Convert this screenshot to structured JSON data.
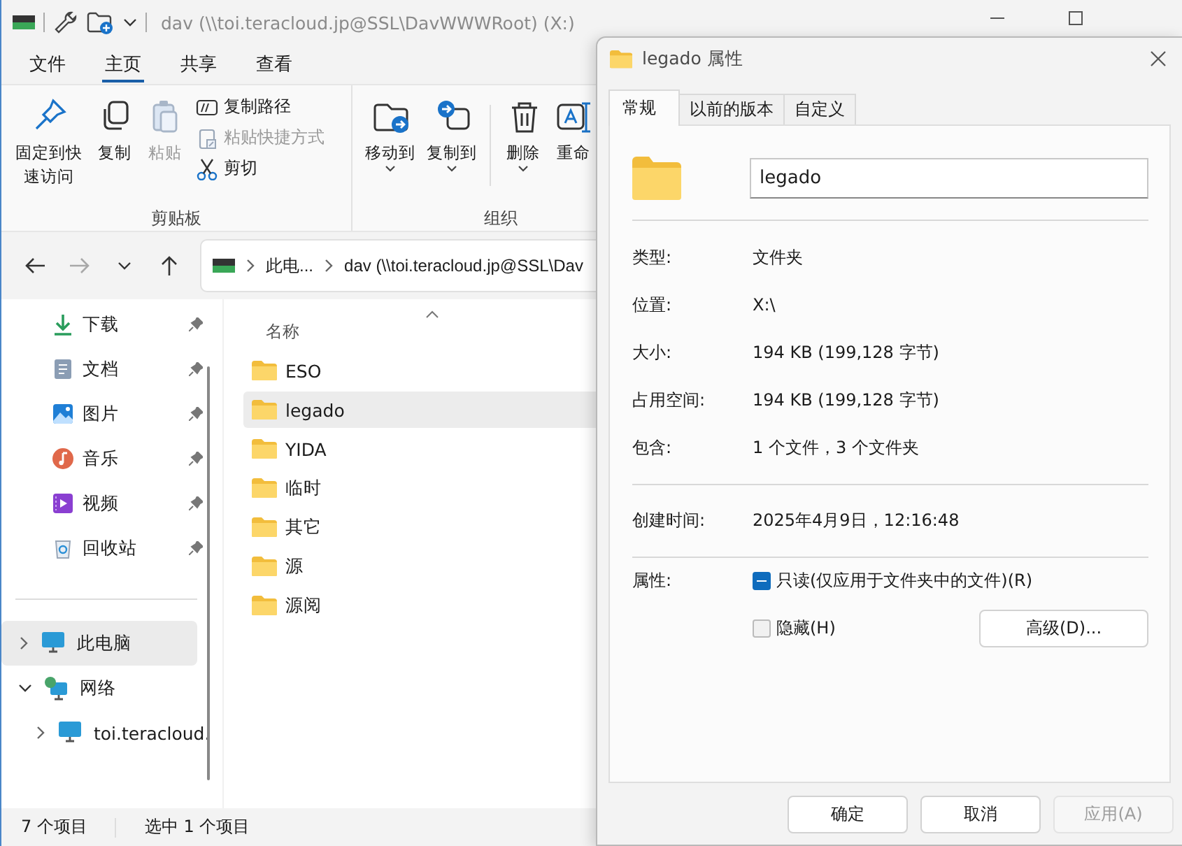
{
  "explorer": {
    "title": "dav (\\\\toi.teracloud.jp@SSL\\DavWWWRoot) (X:)",
    "menu_tabs": [
      {
        "label": "文件",
        "selected": false
      },
      {
        "label": "主页",
        "selected": true
      },
      {
        "label": "共享",
        "selected": false
      },
      {
        "label": "查看",
        "selected": false
      }
    ],
    "ribbon": {
      "groups": [
        {
          "label": "剪贴板",
          "items": [
            {
              "kind": "large",
              "label": "固定到快速访问",
              "disabled": false,
              "dropdown": false
            },
            {
              "kind": "large",
              "label": "复制",
              "disabled": false,
              "dropdown": false
            },
            {
              "kind": "large",
              "label": "粘贴",
              "disabled": true,
              "dropdown": false
            },
            {
              "kind": "small",
              "label": "复制路径",
              "disabled": false
            },
            {
              "kind": "small",
              "label": "粘贴快捷方式",
              "disabled": true
            },
            {
              "kind": "small",
              "label": "剪切",
              "disabled": false
            }
          ]
        },
        {
          "label": "组织",
          "items": [
            {
              "kind": "large",
              "label": "移动到",
              "disabled": false,
              "dropdown": true
            },
            {
              "kind": "large",
              "label": "复制到",
              "disabled": false,
              "dropdown": true
            },
            {
              "kind": "separator"
            },
            {
              "kind": "large",
              "label": "删除",
              "disabled": false,
              "dropdown": true
            },
            {
              "kind": "large",
              "label": "重命",
              "disabled": false,
              "dropdown": false
            }
          ]
        }
      ]
    },
    "address": {
      "crumbs": [
        "此电...",
        "dav (\\\\toi.teracloud.jp@SSL\\Dav"
      ]
    },
    "nav_buttons": [
      {
        "disabled": false
      },
      {
        "disabled": true
      },
      {
        "disabled": false
      },
      {
        "disabled": false
      }
    ],
    "quick_access": [
      {
        "label": "下载",
        "pinned": true
      },
      {
        "label": "文档",
        "pinned": true
      },
      {
        "label": "图片",
        "pinned": true
      },
      {
        "label": "音乐",
        "pinned": true
      },
      {
        "label": "视频",
        "pinned": true
      },
      {
        "label": "回收站",
        "pinned": true
      }
    ],
    "tree": [
      {
        "label": "此电脑",
        "expanded": false,
        "selected": true
      },
      {
        "label": "网络",
        "expanded": true,
        "selected": false,
        "children": [
          {
            "label": "toi.teracloud.",
            "expanded": false,
            "selected": false
          }
        ]
      }
    ],
    "file_list": {
      "column": "名称",
      "rows": [
        {
          "name": "ESO",
          "selected": false
        },
        {
          "name": "legado",
          "selected": true
        },
        {
          "name": "YIDA",
          "selected": false
        },
        {
          "name": "临时",
          "selected": false
        },
        {
          "name": "其它",
          "selected": false
        },
        {
          "name": "源",
          "selected": false
        },
        {
          "name": "源阅",
          "selected": false
        }
      ]
    },
    "status_bar": [
      "7 个项目",
      "选中 1 个项目"
    ]
  },
  "dialog": {
    "title": "legado 属性",
    "tabs": [
      {
        "label": "常规",
        "selected": true
      },
      {
        "label": "以前的版本",
        "selected": false
      },
      {
        "label": "自定义",
        "selected": false
      }
    ],
    "name_value": "legado",
    "sections": [
      [
        {
          "label": "类型:",
          "value": "文件夹"
        },
        {
          "label": "位置:",
          "value": "X:\\"
        },
        {
          "label": "大小:",
          "value": "194 KB (199,128 字节)"
        },
        {
          "label": "占用空间:",
          "value": "194 KB (199,128 字节)"
        },
        {
          "label": "包含:",
          "value": "1 个文件，3 个文件夹"
        }
      ],
      [
        {
          "label": "创建时间:",
          "value": "2025年4月9日，12:16:48"
        }
      ]
    ],
    "attributes": {
      "label": "属性:",
      "options": [
        {
          "label": "只读(仅应用于文件夹中的文件)(R)",
          "checked": false,
          "indeterminate": true
        },
        {
          "label": "隐藏(H)",
          "checked": false,
          "indeterminate": false
        }
      ],
      "advanced_button": "高级(D)..."
    },
    "buttons": [
      {
        "label": "确定",
        "disabled": false
      },
      {
        "label": "取消",
        "disabled": false
      },
      {
        "label": "应用(A)",
        "disabled": true
      }
    ]
  }
}
